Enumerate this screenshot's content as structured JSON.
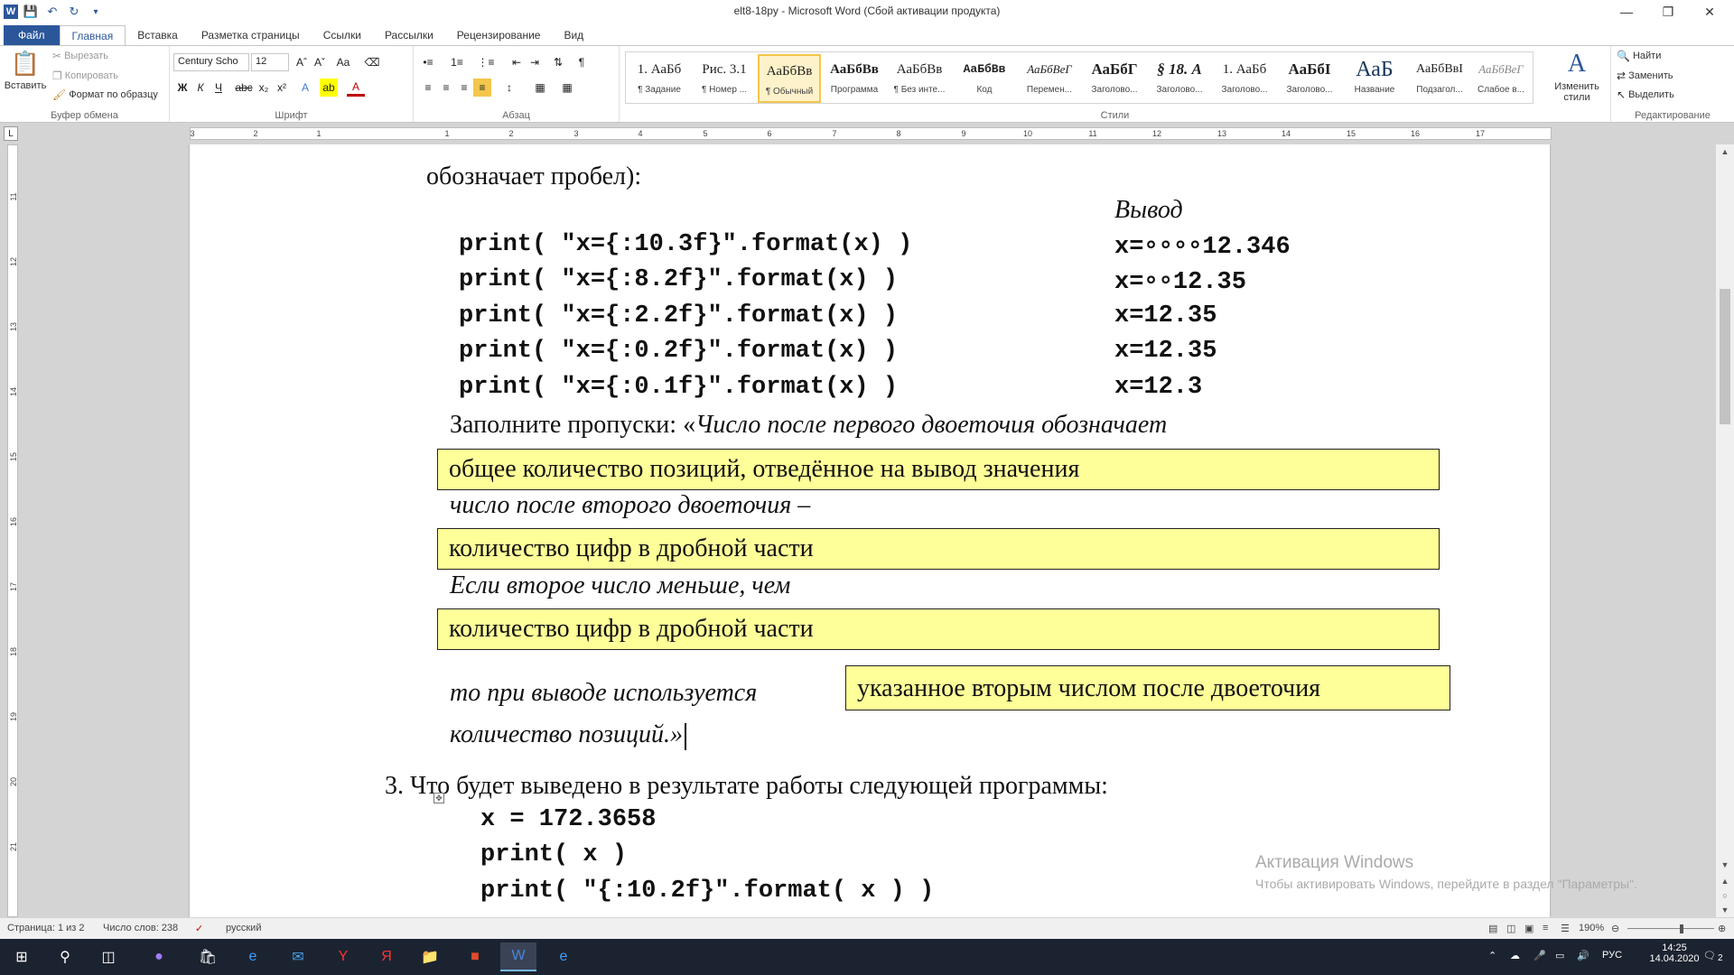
{
  "window": {
    "title": "elt8-18py - Microsoft Word (Сбой активации продукта)"
  },
  "ribbon_tabs": [
    "Файл",
    "Главная",
    "Вставка",
    "Разметка страницы",
    "Ссылки",
    "Рассылки",
    "Рецензирование",
    "Вид"
  ],
  "clipboard": {
    "paste": "Вставить",
    "cut": "Вырезать",
    "copy": "Копировать",
    "format_painter": "Формат по образцу",
    "label": "Буфер обмена"
  },
  "font": {
    "name": "Century Scho",
    "size": "12",
    "label": "Шрифт"
  },
  "paragraph": {
    "label": "Абзац"
  },
  "styles": {
    "label": "Стили",
    "items": [
      {
        "sample": "1. АаБб",
        "name": "¶ Задание"
      },
      {
        "sample": "Рис. 3.1",
        "name": "¶ Номер ..."
      },
      {
        "sample": "АаБбВв",
        "name": "¶ Обычный"
      },
      {
        "sample": "АаБбВв",
        "name": "Программа"
      },
      {
        "sample": "АаБбВв",
        "name": "¶ Без инте..."
      },
      {
        "sample": "АаБбВв",
        "name": "Код"
      },
      {
        "sample": "АаБбВеГ",
        "name": "Перемен..."
      },
      {
        "sample": "АаБбГ",
        "name": "Заголово..."
      },
      {
        "sample": "§ 18. А",
        "name": "Заголово..."
      },
      {
        "sample": "1. АаБб",
        "name": "Заголово..."
      },
      {
        "sample": "АаБбI",
        "name": "Заголово..."
      },
      {
        "sample": "АаБ",
        "name": "Название"
      },
      {
        "sample": "АаБбВвI",
        "name": "Подзагол..."
      },
      {
        "sample": "АаБбВеГ",
        "name": "Слабое в..."
      }
    ],
    "change_styles": "Изменить стили"
  },
  "editing": {
    "find": "Найти",
    "replace": "Заменить",
    "select": "Выделить",
    "label": "Редактирование"
  },
  "ruler": {
    "ticks": [
      "3",
      "2",
      "1",
      "1",
      "2",
      "3",
      "4",
      "5",
      "6",
      "7",
      "8",
      "9",
      "10",
      "11",
      "12",
      "13",
      "14",
      "15",
      "16",
      "17"
    ],
    "vticks": [
      "11",
      "12",
      "13",
      "14",
      "15",
      "16",
      "17",
      "18",
      "19",
      "20",
      "21"
    ]
  },
  "document": {
    "intro_tail": "обозначает пробел):",
    "output_header": "Вывод",
    "code_rows": [
      {
        "code": "print( \"x={:10.3f}\".format(x) )",
        "output": "x=∘∘∘∘12.346"
      },
      {
        "code": "print( \"x={:8.2f}\".format(x) )",
        "output": "x=∘∘12.35"
      },
      {
        "code": "print( \"x={:2.2f}\".format(x) )",
        "output": "x=12.35"
      },
      {
        "code": "print( \"x={:0.2f}\".format(x) )",
        "output": "x=12.35"
      },
      {
        "code": "print( \"x={:0.1f}\".format(x) )",
        "output": "x=12.3"
      }
    ],
    "fill_prompt_plain": "Заполните пропуски: «",
    "fill_prompt_italic": "Число после первого двоеточия обозначает",
    "answer1": "общее количество позиций, отведённое на вывод значения",
    "second_colon": "число после второго двоеточия –",
    "answer2": "количество цифр в дробной части",
    "if_less": "Если второе число меньше, чем",
    "answer3": "количество цифр в дробной части",
    "then_used": "то при выводе используется",
    "answer4": "указанное вторым числом после двоеточия",
    "positions_end": "количество позиций.»",
    "q3": "3. Что будет выведено в результате работы следующей программы:",
    "q3_code": [
      "x = 172.3658",
      "print( x )",
      "print( \"{:10.2f}\".format( x ) )"
    ]
  },
  "watermark": {
    "title": "Активация Windows",
    "subtitle": "Чтобы активировать Windows, перейдите в раздел \"Параметры\"."
  },
  "statusbar": {
    "page": "Страница: 1 из 2",
    "words": "Число слов: 238",
    "language": "русский",
    "zoom": "190%"
  },
  "taskbar": {
    "language": "РУС",
    "time": "14:25",
    "date": "14.04.2020",
    "notifications": "2"
  }
}
